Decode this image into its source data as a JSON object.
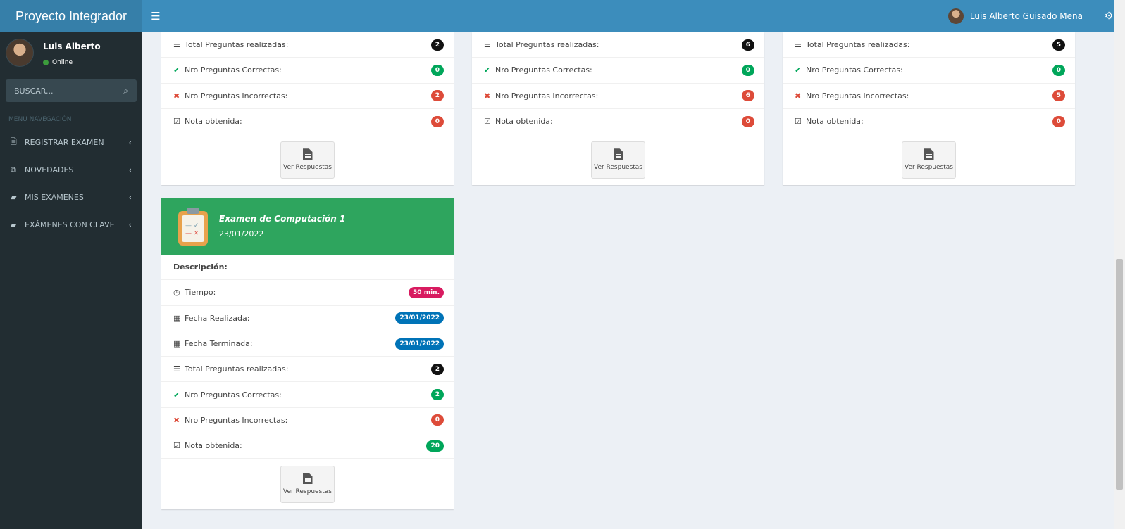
{
  "app": {
    "title": "Proyecto Integrador"
  },
  "topbar": {
    "user_name": "Luis Alberto Guisado Mena"
  },
  "sidebar": {
    "user": {
      "name": "Luis Alberto",
      "status": "Online"
    },
    "search": {
      "placeholder": "BUSCAR..."
    },
    "menu_header": "MENU NAVEGACIÓN",
    "items": [
      {
        "label": "REGISTRAR EXAMEN",
        "icon": "file-text-icon"
      },
      {
        "label": "NOVEDADES",
        "icon": "clone-icon"
      },
      {
        "label": "MIS EXÁMENES",
        "icon": "book-icon"
      },
      {
        "label": "EXÁMENES CON CLAVE",
        "icon": "book-icon"
      }
    ]
  },
  "labels": {
    "descripcion": "Descripción:",
    "tiempo": "Tiempo:",
    "fecha_realizada": "Fecha Realizada:",
    "fecha_terminada": "Fecha Terminada:",
    "total": "Total Preguntas realizadas:",
    "correctas": "Nro Preguntas Correctas:",
    "incorrectas": "Nro Preguntas Incorrectas:",
    "nota": "Nota obtenida:",
    "ver_respuestas": "Ver Respuestas"
  },
  "top_cards": [
    {
      "total": "2",
      "correctas": "0",
      "incorrectas": "2",
      "nota": "0"
    },
    {
      "total": "6",
      "correctas": "0",
      "incorrectas": "6",
      "nota": "0"
    },
    {
      "total": "5",
      "correctas": "0",
      "incorrectas": "5",
      "nota": "0"
    }
  ],
  "exam_card": {
    "title": "Examen de Computación 1",
    "date": "23/01/2022",
    "tiempo": "50 min.",
    "fecha_realizada": "23/01/2022",
    "fecha_terminada": "23/01/2022",
    "total": "2",
    "correctas": "2",
    "incorrectas": "0",
    "nota": "20"
  },
  "colors": {
    "header_blue": "#3c8dbc",
    "logo_blue": "#367fa9",
    "sidebar_dark": "#222d32",
    "success_green": "#00a65a",
    "danger_red": "#dd4b39",
    "card_header_green": "#2ea55e"
  }
}
